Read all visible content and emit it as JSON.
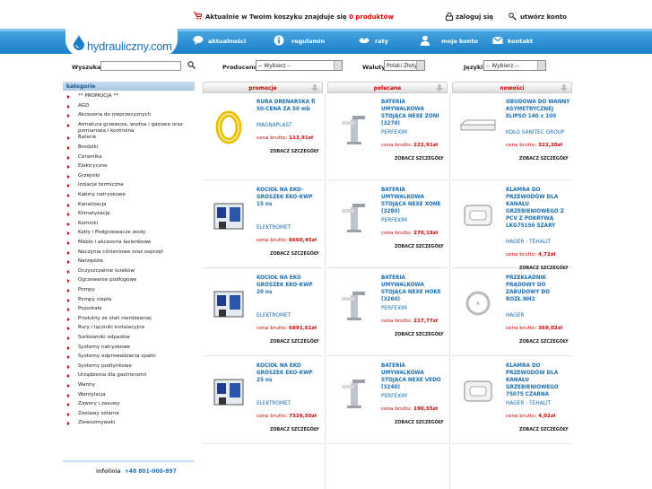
{
  "header": {
    "cart_prefix": "Aktualnie w Twoim koszyku znajduje się",
    "cart_count": "0 produktów",
    "login": "zaloguj się",
    "create_account": "utwórz konto"
  },
  "logo": {
    "text": "hydrauliczny.com"
  },
  "nav": [
    {
      "label": "aktualności",
      "icon": "speech-bubble-icon"
    },
    {
      "label": "regulamin",
      "icon": "info-icon"
    },
    {
      "label": "raty",
      "icon": "handshake-icon"
    },
    {
      "label": "moje konto",
      "icon": "user-icon"
    },
    {
      "label": "kontakt",
      "icon": "envelope-icon"
    }
  ],
  "search": {
    "label": "Wyszukaj",
    "value": "",
    "producers_label": "Producenci",
    "producers_value": "-- Wybierz --",
    "currency_label": "Waluty",
    "currency_value": "Polski Złoty",
    "language_label": "Języki",
    "language_value": "-- Wybierz --"
  },
  "sidebar": {
    "title": "kategorie",
    "categories": [
      "** PROMOCJA **",
      "AGD",
      "Akcesoria do nieprzecyznych",
      "Armatura grzewcza, wodna i gazowa oraz",
      "pomiarowa i kontrolna",
      "Baterie",
      "Brodziki",
      "Ceramika",
      "Elektryczne",
      "Grzejniki",
      "Izolacje termiczne",
      "Kabiny natryskowe",
      "Kanalizacja",
      "Klimatyzacja",
      "Kominki",
      "Kotły i Podgrzewacze wody",
      "Meble i akcesoria łazienkowe",
      "Naczynia cśnieniowe oraz osprzęt",
      "Narzędzia",
      "Oczyszczalnie ścieków",
      "Ogrzewanie podłogowe",
      "Pompy",
      "Pompy ciepła",
      "Pozostałe",
      "Produkty ze stali nierdzewnej",
      "Rury i łączniki instalacyjne",
      "Sorbowniki odpadów",
      "Systemy natryskowe",
      "Systemy odprowadzania spalin",
      "Systemy podtynkowe",
      "Urządzenia dla gastronomii",
      "Wanny",
      "Wentylacja",
      "Zawory i zasuwy",
      "Zestawy solarne",
      "Zlewozmywaki"
    ],
    "infolinia_label": "infolinia",
    "infolinia_phone": "+48 801-000-897"
  },
  "columns": [
    {
      "title": "promocje",
      "items": [
        {
          "name": "RURA DRENARSKA fi 50-CENA ZA 50 mb",
          "maker": "MAGNAPLAST",
          "price_label": "cena brutto:",
          "price": "113,91zł",
          "more": "ZOBACZ SZCZEGÓŁY"
        },
        {
          "name": "KOCIOŁ NA EKO-GROSZEK EKO-KWP 15 ns",
          "maker": "ELEKTROMET",
          "price_label": "cena brutto:",
          "price": "6660,45zł",
          "more": "ZOBACZ SZCZEGÓŁY"
        },
        {
          "name": "KOCIOŁ NA EKO GROSZEK EKO-KWP 20 ns",
          "maker": "ELEKTROMET",
          "price_label": "cena brutto:",
          "price": "6891,61zł",
          "more": "ZOBACZ SZCZEGÓŁY"
        },
        {
          "name": "KOCIOŁ NA EKO GROSZEK EKO-KWP 25 ns",
          "maker": "ELEKTROMET",
          "price_label": "cena brutto:",
          "price": "7326,50zł",
          "more": "ZOBACZ SZCZEGÓŁY"
        }
      ]
    },
    {
      "title": "polecane",
      "items": [
        {
          "name": "BATERIA UMYWALKOWA STOJĄCA NEXE ZONI (3270)",
          "maker": "PERFEXIM",
          "price_label": "cena brutto:",
          "price": "222,91zł",
          "more": "ZOBACZ SZCZEGÓŁY"
        },
        {
          "name": "BATERIA UMYWALKOWA STOJĄCA NEXE XONE (3280)",
          "maker": "PERFEXIM",
          "price_label": "cena brutto:",
          "price": "270,19zł",
          "more": "ZOBACZ SZCZEGÓŁY"
        },
        {
          "name": "BATERIA UMYWALKOWA STOJĄCA NEXE HOKE (3260)",
          "maker": "PERFEXIM",
          "price_label": "cena brutto:",
          "price": "217,77zł",
          "more": "ZOBACZ SZCZEGÓŁY"
        },
        {
          "name": "BATERIA UMYWALKOWA STOJĄCA NEXE VEDO (3240)",
          "maker": "PERFEXIM",
          "price_label": "cena brutto:",
          "price": "190,55zł",
          "more": "ZOBACZ SZCZEGÓŁY"
        }
      ]
    },
    {
      "title": "nowości",
      "items": [
        {
          "name": "OBUDOWA DO WANNY ASYMETRYCZNEJ ELIPSO 140 x 100",
          "maker": "KOŁO SANITEC GROUP",
          "price_label": "cena brutto:",
          "price": "322,20zł",
          "more": "ZOBACZ SZCZEGÓŁY"
        },
        {
          "name": "KLAMRA DO PRZEWODÓW DLA KANAŁU GRZEBIENIOWEGO Z PCV Z POKRYWĄ LKG75150 SZARY",
          "maker": "HAGER - TEHALIT",
          "price_label": "cena brutto:",
          "price": "4,72zł",
          "more": "ZOBACZ SZCZEGÓŁY"
        },
        {
          "name": "PRZEKŁADNIK PRĄDOWY DO ZABUDOWY DO ROZŁ.NH2",
          "maker": "HAGER",
          "price_label": "cena brutto:",
          "price": "369,02zł",
          "more": "ZOBACZ SZCZEGÓŁY"
        },
        {
          "name": "KLAMRA DO PRZEWODÓW DLA KANAŁU GRZEBIENIOWEGO 75075 CZARNA",
          "maker": "HAGER - TEHALIT",
          "price_label": "cena brutto:",
          "price": "4,02zł",
          "more": "ZOBACZ SZCZEGÓŁY"
        }
      ]
    }
  ]
}
